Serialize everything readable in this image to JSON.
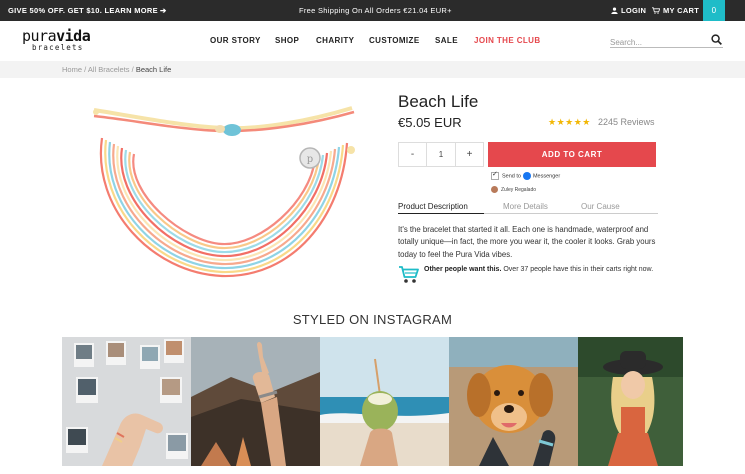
{
  "topbar": {
    "promo": "GIVE 50% OFF. GET $10. LEARN MORE",
    "shipping": "Free Shipping On All Orders €21.04 EUR+",
    "login": "LOGIN",
    "cart": "MY CART",
    "cart_count": "0"
  },
  "logo": {
    "line1_a": "pura",
    "line1_b": "vida",
    "line2": "bracelets"
  },
  "nav": [
    {
      "label": "OUR STORY"
    },
    {
      "label": "SHOP"
    },
    {
      "label": "CHARITY"
    },
    {
      "label": "CUSTOMIZE"
    },
    {
      "label": "SALE"
    },
    {
      "label": "JOIN THE CLUB"
    }
  ],
  "search": {
    "placeholder": "Search..."
  },
  "breadcrumb": {
    "home": "Home",
    "sep1": " / ",
    "category": "All Bracelets",
    "sep2": " / ",
    "current": "Beach Life"
  },
  "product": {
    "title": "Beach Life",
    "price": "€5.05 EUR",
    "stars": "★★★★★",
    "reviews": "2245 Reviews",
    "qty_minus": "-",
    "qty_value": "1",
    "qty_plus": "+",
    "add_to_cart": "ADD TO CART",
    "send_to": "Send to",
    "messenger": "Messenger",
    "user_name": "Zuley Regalado"
  },
  "tabs": [
    {
      "label": "Product Description"
    },
    {
      "label": "More Details"
    },
    {
      "label": "Our Cause"
    }
  ],
  "description": "It's the bracelet that started it all. Each one is handmade, waterproof and totally unique—in fact, the more you wear it, the cooler it looks. Grab yours today to feel the Pura Vida vibes.",
  "social_proof": {
    "bold": "Other people want this.",
    "text": " Over 37 people have this in their carts right now."
  },
  "instagram": {
    "heading": "STYLED ON INSTAGRAM"
  },
  "colors": {
    "accent": "#e5484d",
    "teal": "#1fbcc8",
    "topbar": "#2b2b2b"
  }
}
